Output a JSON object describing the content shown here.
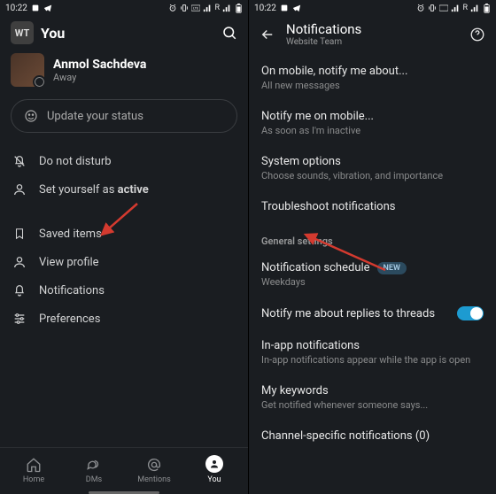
{
  "statusbar": {
    "time": "10:22"
  },
  "left": {
    "workspace_abbr": "WT",
    "you_label": "You",
    "profile": {
      "name": "Anmol Sachdeva",
      "presence": "Away"
    },
    "status_placeholder": "Update your status",
    "menu": {
      "dnd": "Do not disturb",
      "active_prefix": "Set yourself as ",
      "active_bold": "active",
      "saved": "Saved items",
      "view_profile": "View profile",
      "notifications": "Notifications",
      "preferences": "Preferences"
    },
    "nav": {
      "home": "Home",
      "dms": "DMs",
      "mentions": "Mentions",
      "you": "You"
    }
  },
  "right": {
    "header": {
      "title": "Notifications",
      "subtitle": "Website Team"
    },
    "items": {
      "on_mobile": {
        "title": "On mobile, notify me about...",
        "sub": "All new messages"
      },
      "notify_mobile": {
        "title": "Notify me on mobile...",
        "sub": "As soon as I'm inactive"
      },
      "system": {
        "title": "System options",
        "sub": "Choose sounds, vibration, and importance"
      },
      "troubleshoot": {
        "title": "Troubleshoot notifications"
      },
      "section": "General settings",
      "schedule": {
        "title": "Notification schedule",
        "badge": "NEW",
        "sub": "Weekdays"
      },
      "threads": {
        "title": "Notify me about replies to threads"
      },
      "inapp": {
        "title": "In-app notifications",
        "sub": "In-app notifications appear while the app is open"
      },
      "keywords": {
        "title": "My keywords",
        "sub": "Get notified whenever someone says..."
      },
      "channel": {
        "title": "Channel-specific notifications (0)"
      }
    }
  }
}
